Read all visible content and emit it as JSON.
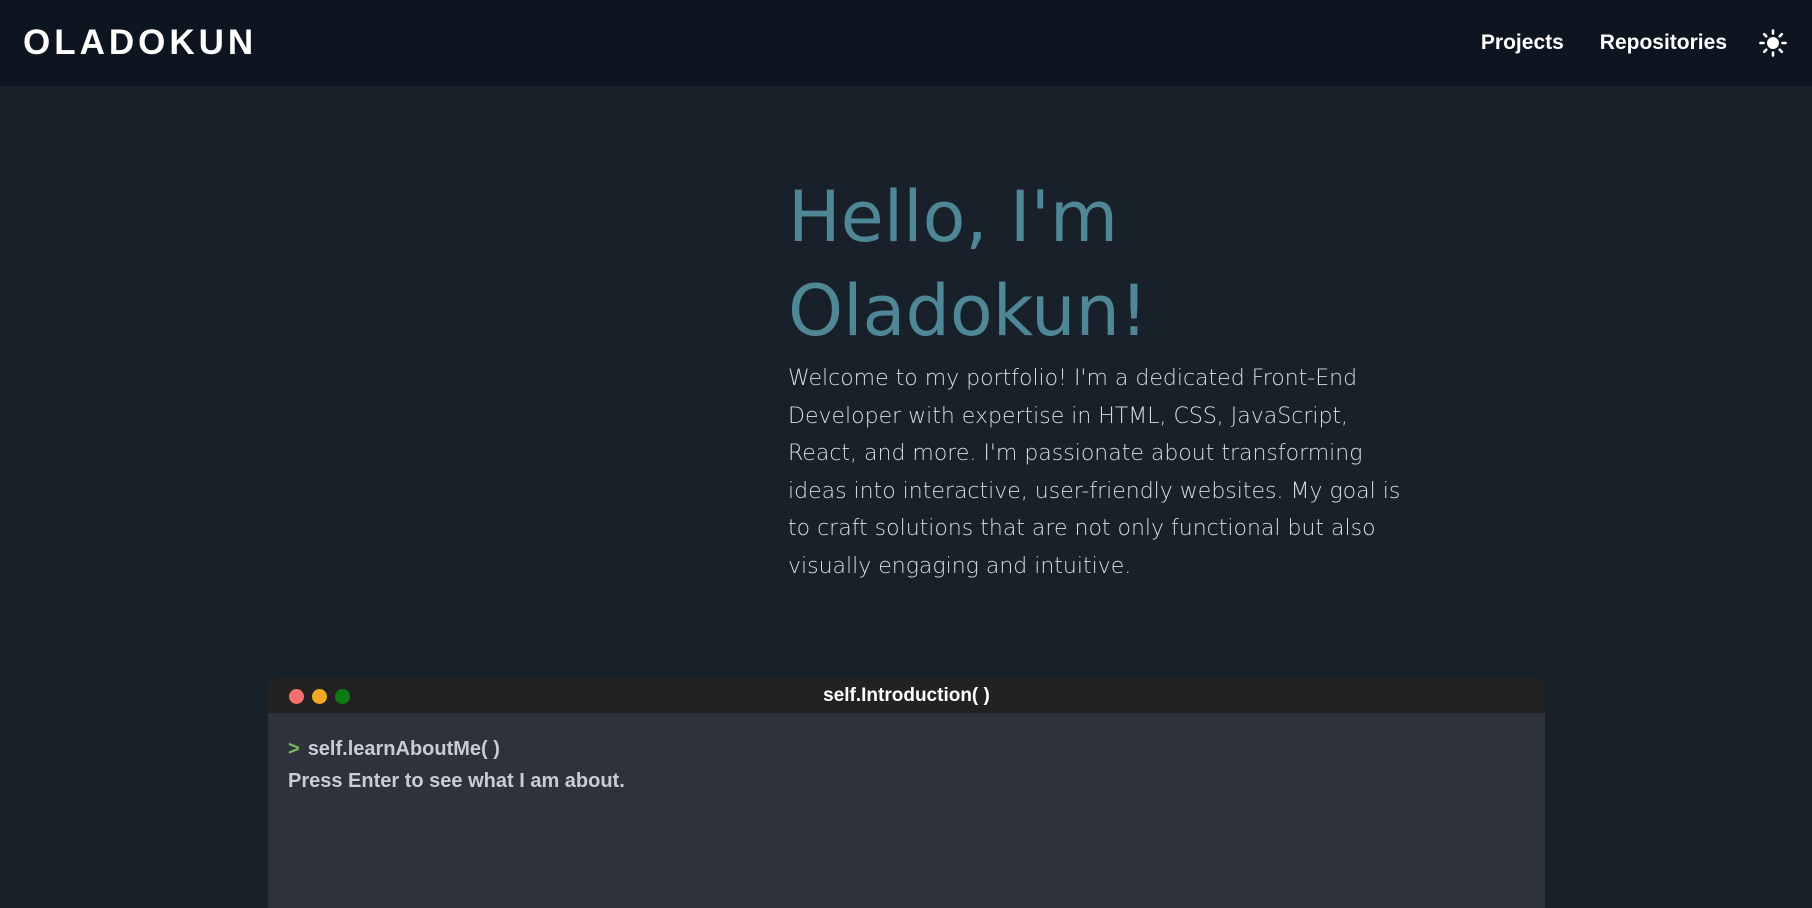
{
  "header": {
    "brand": "OLADOKUN",
    "nav": [
      {
        "label": "Projects"
      },
      {
        "label": "Repositories"
      }
    ],
    "theme_icon": "sun-icon"
  },
  "hero": {
    "title_line1": "Hello, I'm",
    "title_line2": "Oladokun!",
    "intro": "Welcome to my portfolio! I'm a dedicated Front-End Developer with expertise in HTML, CSS, JavaScript, React, and more. I'm passionate about transforming ideas into interactive, user-friendly websites. My goal is to craft solutions that are not only functional but also visually engaging and intuitive."
  },
  "terminal": {
    "title": "self.Introduction( )",
    "prompt": ">",
    "command": "self.learnAboutMe( )",
    "hint": "Press Enter to see what I am about.",
    "dot_colors": [
      "#f96e6e",
      "#f5a623",
      "#0a7d12"
    ]
  },
  "colors": {
    "background": "#18202a",
    "header_bg": "#0c1520",
    "accent": "#4f8796",
    "prompt_green": "#7bb661"
  }
}
